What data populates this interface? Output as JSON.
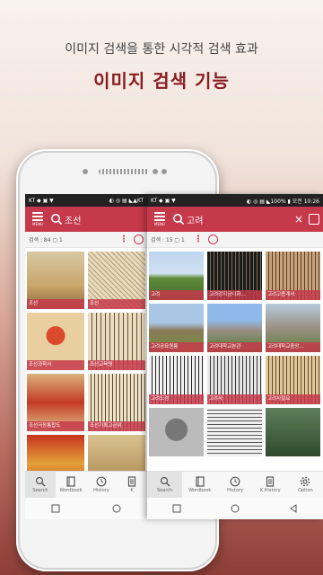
{
  "promo": {
    "subtitle": "이미지 검색을 통한 시각적 검색 효과",
    "title": "이미지 검색 기능"
  },
  "colors": {
    "accent": "#c6394a",
    "title": "#8a1c22"
  },
  "screen_left": {
    "status_left": "KT ◆ ▣ ▼",
    "status_right": "◐ ◎ ▤ ◣▲KT",
    "menu_label": "MENU",
    "query": "조선",
    "result_count": "검색 : 84 ▢ 1",
    "tiles": [
      {
        "caption": "조선",
        "thumb": "ship-painting"
      },
      {
        "caption": "조선",
        "thumb": "map-drawing"
      },
      {
        "caption": "조선과학사",
        "thumb": "book-cover"
      },
      {
        "caption": "조선교육령",
        "thumb": "document-page"
      },
      {
        "caption": "조선극장통합도",
        "thumb": "book-cover-red"
      },
      {
        "caption": "조선기록고금위",
        "thumb": "document-text"
      },
      {
        "caption": "",
        "thumb": "red-book"
      },
      {
        "caption": "",
        "thumb": "old-book"
      }
    ],
    "nav": [
      {
        "label": "Search",
        "icon": "search-icon"
      },
      {
        "label": "Wordbook",
        "icon": "book-icon"
      },
      {
        "label": "History",
        "icon": "clock-icon"
      },
      {
        "label": "K",
        "icon": "doc-icon"
      }
    ]
  },
  "screen_right": {
    "status_left": "KT ◆ ▣ ▼",
    "status_right": "◐ ◎ ▤ ◣100% ▮ 오전 10:26",
    "menu_label": "MENU",
    "query": "고려",
    "close_glyph": "×",
    "result_count": "검색 : 15 ▢ 1",
    "tiles": [
      {
        "caption": "고려",
        "thumb": "landscape"
      },
      {
        "caption": "고려강지금니화…",
        "thumb": "dark-scroll"
      },
      {
        "caption": "고려고종계서",
        "thumb": "brown-text"
      },
      {
        "caption": "고려공묘원릉",
        "thumb": "tomb"
      },
      {
        "caption": "고려대학교본관",
        "thumb": "building"
      },
      {
        "caption": "고려대학교중앙…",
        "thumb": "stone-building"
      },
      {
        "caption": "고려도경",
        "thumb": "bw-text"
      },
      {
        "caption": "고려사",
        "thumb": "bw-text2"
      },
      {
        "caption": "고려사절요",
        "thumb": "tan-text"
      },
      {
        "caption": "",
        "thumb": "statue"
      },
      {
        "caption": "",
        "thumb": "paper-text"
      },
      {
        "caption": "",
        "thumb": "green-stone"
      }
    ],
    "nav": [
      {
        "label": "Search",
        "icon": "search-icon"
      },
      {
        "label": "Wordbook",
        "icon": "book-icon"
      },
      {
        "label": "History",
        "icon": "clock-icon"
      },
      {
        "label": "K.History",
        "icon": "doc-icon"
      },
      {
        "label": "Option",
        "icon": "gear-icon"
      }
    ]
  }
}
